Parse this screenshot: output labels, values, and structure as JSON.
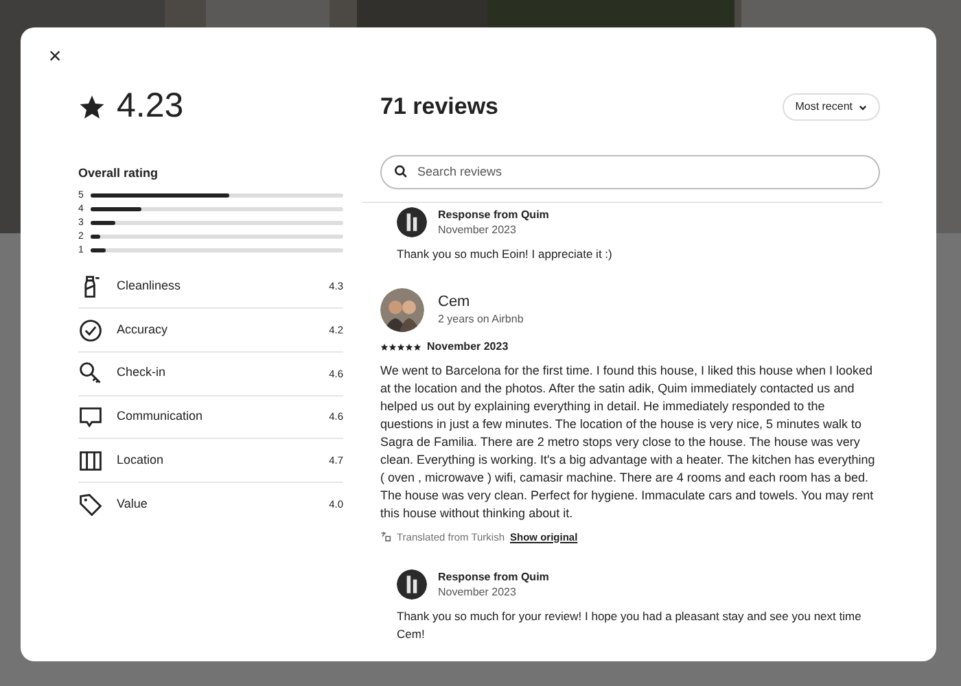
{
  "dialog": {
    "close": "×",
    "summary": {
      "score": "4.23",
      "overall_label": "Overall rating",
      "distribution": [
        {
          "label": "5",
          "level": 0.55
        },
        {
          "label": "4",
          "level": 0.2
        },
        {
          "label": "3",
          "level": 0.1
        },
        {
          "label": "2",
          "level": 0.04
        },
        {
          "label": "1",
          "level": 0.06
        }
      ],
      "categories": [
        {
          "kind": "cleanliness",
          "name": "Cleanliness",
          "score": "4.3"
        },
        {
          "kind": "accuracy",
          "name": "Accuracy",
          "score": "4.2"
        },
        {
          "kind": "checkin",
          "name": "Check-in",
          "score": "4.6"
        },
        {
          "kind": "communication",
          "name": "Communication",
          "score": "4.6"
        },
        {
          "kind": "location",
          "name": "Location",
          "score": "4.7"
        },
        {
          "kind": "value",
          "name": "Value",
          "score": "4.0"
        }
      ]
    },
    "title": "71 reviews",
    "sort": "Most recent",
    "search": {
      "placeholder": "Search reviews"
    },
    "feed": [
      {
        "kind": "response",
        "author": "Response from Quim",
        "date": "November 2023",
        "text": "Thank you so much Eoin! I appreciate it :)"
      },
      {
        "kind": "review",
        "author": "Cem",
        "meta": "2 years on Airbnb",
        "stars": 5,
        "date": "November 2023",
        "text": "We went to Barcelona for the first time. I found this house, I liked this house when I looked at the location and the photos. After the satin adik, Quim immediately contacted us and helped us out by explaining everything in detail. He immediately responded to the questions in just a few minutes. The location of the house is very nice, 5 minutes walk to Sagra de Familia. There are 2 metro stops very close to the house. The house was very clean. Everything is working. It's a big advantage with a heater. The kitchen has everything ( oven , microwave ) wifi, camasir machine. There are 4 rooms and each room has a bed. The house was very clean. Perfect for hygiene. Immaculate cars and towels. You may rent this house without thinking about it.",
        "translated": "Translated from Turkish",
        "show_original": "Show original"
      },
      {
        "kind": "response",
        "author": "Response from Quim",
        "date": "November 2023",
        "text": "Thank you so much for your review! I hope you had a pleasant stay and see you next time Cem!"
      }
    ]
  }
}
